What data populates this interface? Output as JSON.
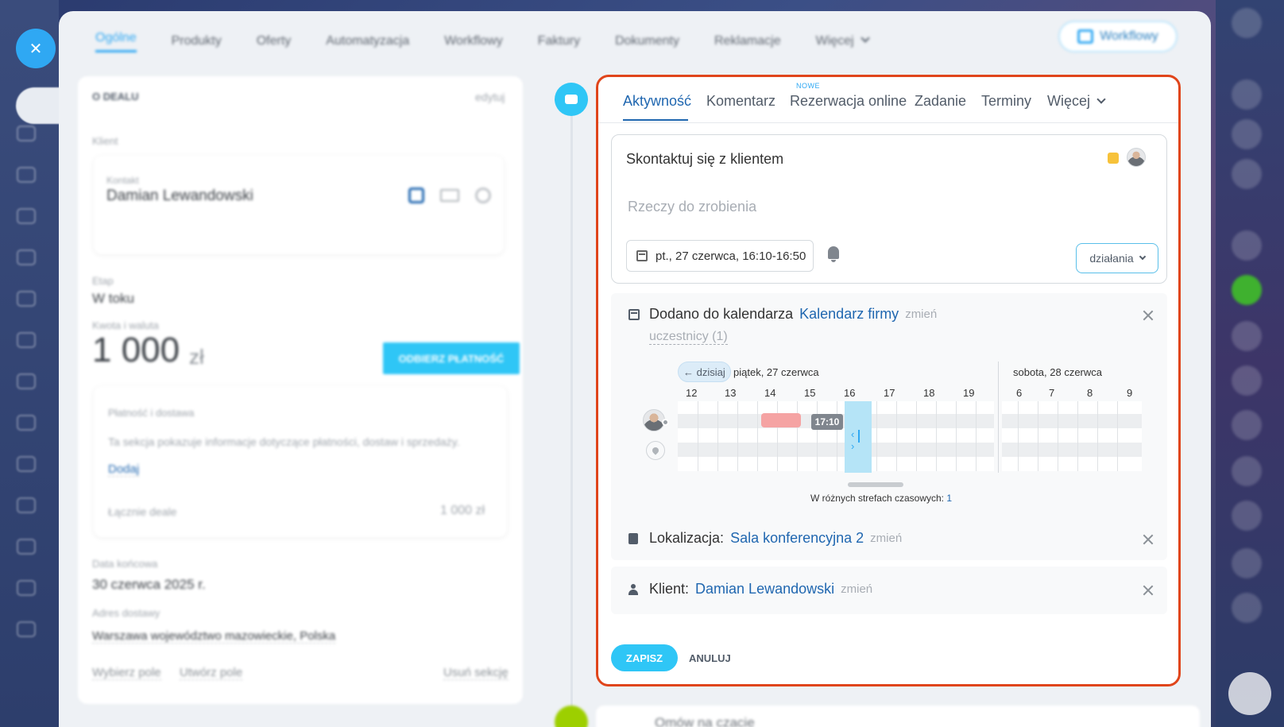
{
  "crm_tabs": {
    "items": [
      "Ogólne",
      "Produkty",
      "Oferty",
      "Automatyzacja",
      "Workflowy",
      "Faktury",
      "Dokumenty",
      "Reklamacje",
      "Więcej"
    ],
    "workflow_button": "Workflowy"
  },
  "deal_card": {
    "section_title": "O DEALU",
    "edit_link": "edytuj",
    "client_label": "Klient",
    "contact_label": "Kontakt",
    "contact_name": "Damian Lewandowski",
    "stage_label": "Etap",
    "stage_value": "W toku",
    "amount_label": "Kwota i waluta",
    "amount_value": "1 000",
    "currency": "zł",
    "pay_button": "ODBIERZ PŁATNOŚĆ",
    "payment_title": "Płatność i dostawa",
    "payment_desc": "Ta sekcja pokazuje informacje dotyczące płatności, dostaw i sprzedaży.",
    "add_link": "Dodaj",
    "total_label": "Łącznie deale",
    "total_value": "1 000 zł",
    "end_date_label": "Data końcowa",
    "end_date_value": "30 czerwca 2025 r.",
    "address_label": "Adres dostawy",
    "address_value": "Warszawa województwo mazowieckie, Polska",
    "choose_field": "Wybierz pole",
    "create_field": "Utwórz pole",
    "delete_section": "Usuń sekcję"
  },
  "editor_tabs": {
    "activity": "Aktywność",
    "comment": "Komentarz",
    "online_booking": "Rezerwacja online",
    "new_badge": "NOWE",
    "task": "Zadanie",
    "deadlines": "Terminy",
    "more": "Więcej"
  },
  "todo": {
    "title": "Skontaktuj się z klientem",
    "placeholder": "Rzeczy do zrobienia",
    "datetime": "pt., 27 czerwca, 16:10-16:50",
    "actions_button": "działania"
  },
  "calendar_block": {
    "added_label": "Dodano do kalendarza",
    "calendar_name": "Kalendarz firmy",
    "change": "zmień",
    "participants": "uczestnicy (1)",
    "today_button": "← dzisiaj",
    "day1": "piątek, 27 czerwca",
    "day2": "sobota, 28 czerwca",
    "hours_day1": [
      "12",
      "13",
      "14",
      "15",
      "16",
      "17",
      "18",
      "19"
    ],
    "hours_day2": [
      "6",
      "7",
      "8",
      "9"
    ],
    "time_badge": "17:10",
    "timezone_note": "W różnych strefach czasowych:",
    "timezone_count": "1"
  },
  "location_block": {
    "label": "Lokalizacja:",
    "value": "Sala konferencyjna 2",
    "change": "zmień"
  },
  "client_block": {
    "label": "Klient:",
    "value": "Damian Lewandowski",
    "change": "zmień"
  },
  "footer": {
    "save": "ZAPISZ",
    "cancel": "ANULUJ"
  },
  "timeline_next": "Omów na czacie",
  "colors": {
    "accent": "#2fc6f6",
    "link": "#2067b0",
    "highlight_border": "#e0451b",
    "busy": "#f5a3a3",
    "selected": "#b5e4f7",
    "flag": "#f7c23a"
  }
}
